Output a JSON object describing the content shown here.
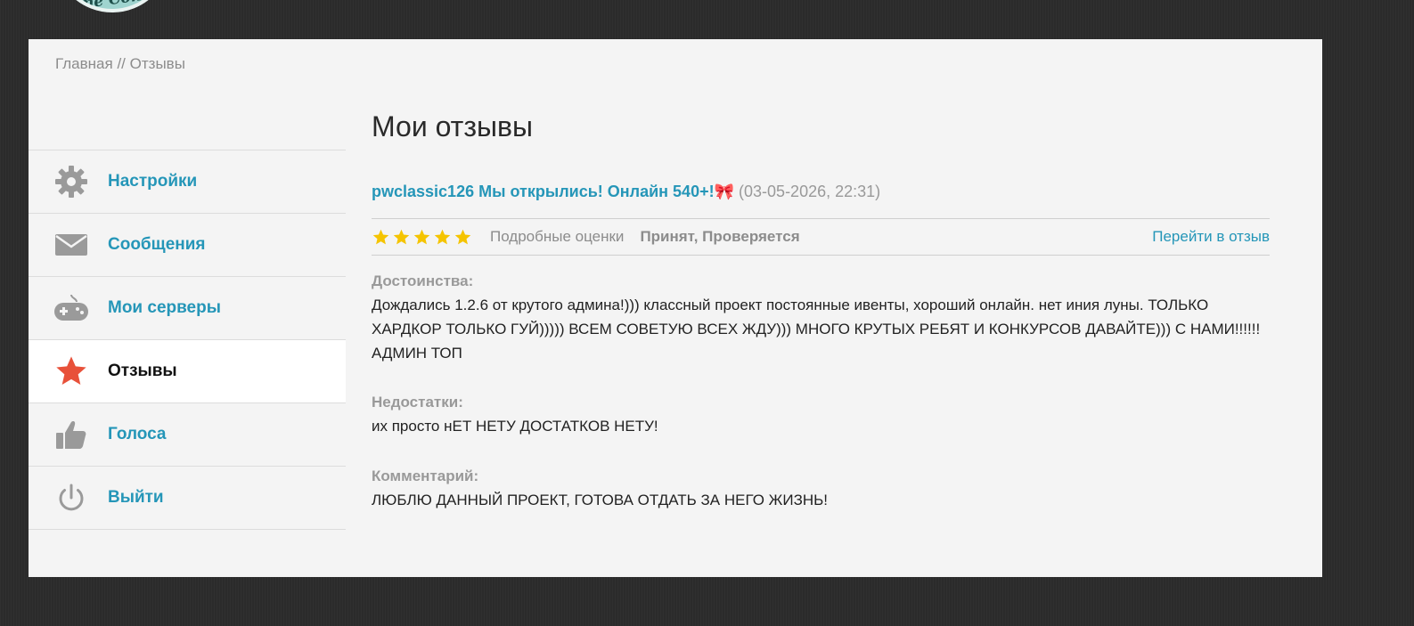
{
  "breadcrumb": {
    "home": "Главная",
    "separator": "//",
    "current": "Отзывы"
  },
  "sidebar": {
    "items": [
      {
        "label": "Настройки",
        "icon": "gear-icon",
        "active": false
      },
      {
        "label": "Сообщения",
        "icon": "envelope-icon",
        "active": false
      },
      {
        "label": "Мои серверы",
        "icon": "gamepad-icon",
        "active": false
      },
      {
        "label": "Отзывы",
        "icon": "star-icon",
        "active": true
      },
      {
        "label": "Голоса",
        "icon": "thumbs-up-icon",
        "active": false
      },
      {
        "label": "Выйти",
        "icon": "power-icon",
        "active": false
      }
    ]
  },
  "main": {
    "title": "Мои отзывы",
    "review": {
      "server": "pwclassic126",
      "headline": "Мы открылись! Онлайн 540+!",
      "emoji": "🎀",
      "date": "(03-05-2026, 22:31)",
      "rating": 5,
      "rating_max": 5,
      "details_label": "Подробные оценки",
      "status": "Принят, Проверяется",
      "goto_label": "Перейти в отзыв",
      "pros_title": "Достоинства:",
      "pros_text": "Дождались 1.2.6 от крутого админа!))) классный проект постоянные ивенты, хороший онлайн. нет иния луны. ТОЛЬКО ХАРДКОР ТОЛЬКО ГУЙ))))) ВСЕМ СОВЕТУЮ ВСЕХ ЖДУ))) МНОГО КРУТЫХ РЕБЯТ И КОНКУРСОВ ДАВАЙТЕ))) С НАМИ!!!!!! АДМИН ТОП",
      "cons_title": "Недостатки:",
      "cons_text": "их просто нЕТ НЕТУ ДОСТАТКОВ НЕТУ!",
      "comment_title": "Комментарий:",
      "comment_text": "ЛЮБЛЮ ДАННЫЙ ПРОЕКТ, ГОТОВА ОТДАТЬ ЗА НЕГО ЖИЗНЬ!"
    }
  },
  "colors": {
    "accent": "#2596b8",
    "star": "#f5c400",
    "active_star_icon": "#e8513a",
    "muted": "#999999"
  }
}
